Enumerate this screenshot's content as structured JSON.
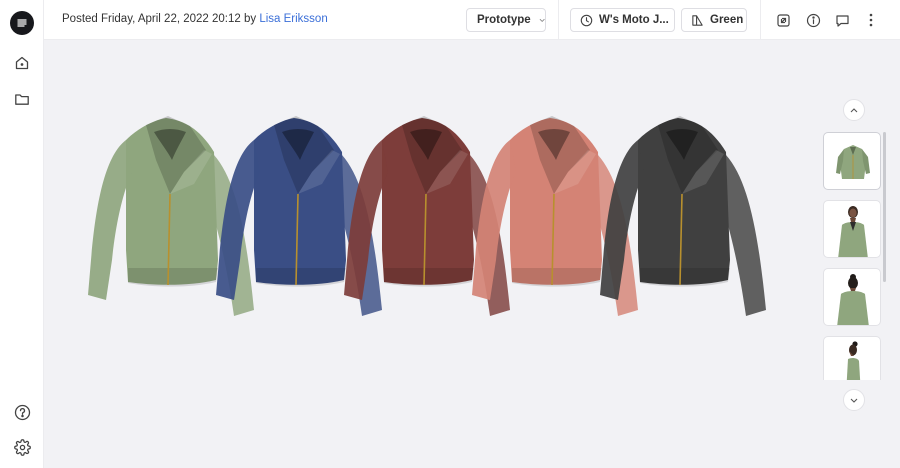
{
  "header": {
    "posted_prefix": "Posted Friday, April 22, 2022 20:12 by ",
    "author": "Lisa Eriksson",
    "status_label": "Prototype",
    "style_label": "W's Moto J...",
    "colorway_label": "Green"
  },
  "colors": {
    "accent_link": "#3b6fd8",
    "jacket_green": "#8fa67e",
    "jacket_blue": "#3a4e85",
    "jacket_maroon": "#7d3d3a",
    "jacket_salmon": "#d48375",
    "jacket_charcoal": "#404040"
  },
  "icons": {
    "logo": "menu-lines-logo",
    "home": "home-icon",
    "folder": "folder-icon",
    "help": "help-icon",
    "settings": "gear-icon",
    "history": "clock-icon",
    "colorway": "swatch-icon",
    "expand": "expand-icon",
    "info": "info-icon",
    "comment": "comment-icon",
    "more": "more-vertical-icon"
  },
  "thumbnails": [
    {
      "view": "front-flat",
      "selected": true
    },
    {
      "view": "avatar-front",
      "selected": false
    },
    {
      "view": "avatar-back",
      "selected": false
    },
    {
      "view": "avatar-side",
      "selected": false
    }
  ]
}
